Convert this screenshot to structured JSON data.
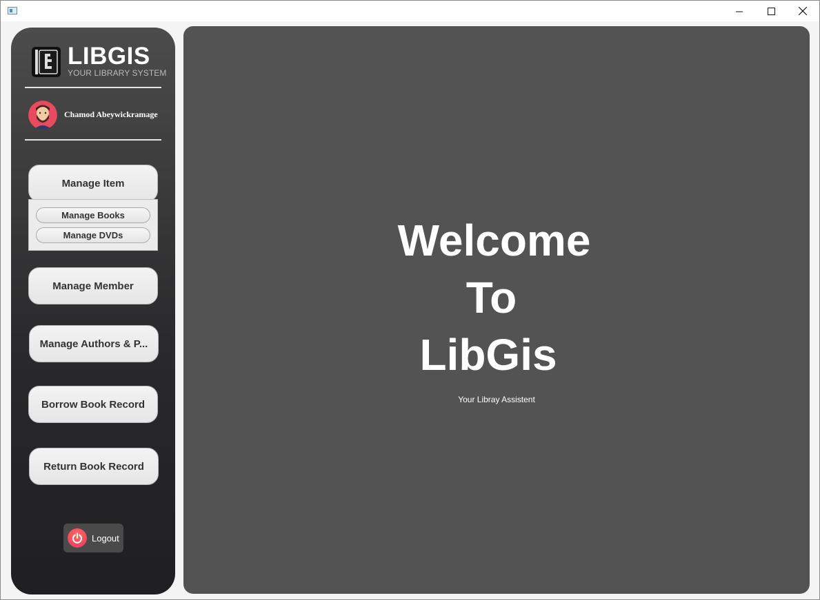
{
  "titlebar": {
    "minimize_icon": "minimize-icon",
    "maximize_icon": "maximize-icon",
    "close_icon": "close-icon"
  },
  "sidebar": {
    "brand_title": "LIBGIS",
    "brand_subtitle": "YOUR LIBRARY SYSTEM",
    "user_name": "Chamod Abeywickramage",
    "nav": {
      "manage_item": "Manage Item",
      "manage_books": "Manage Books",
      "manage_dvds": "Manage DVDs",
      "manage_member": "Manage Member",
      "manage_authors": "Manage Authors & P...",
      "borrow_record": "Borrow Book Record",
      "return_record": "Return Book Record"
    },
    "logout_label": "Logout"
  },
  "main": {
    "welcome_line1": "Welcome",
    "welcome_line2": "To",
    "welcome_line3": "LibGis",
    "tagline": "Your Libray Assistent"
  },
  "colors": {
    "sidebar_top": "#4c4c4c",
    "sidebar_bottom": "#1f1f21",
    "main_bg": "#535353",
    "power_accent": "#e8356b"
  }
}
